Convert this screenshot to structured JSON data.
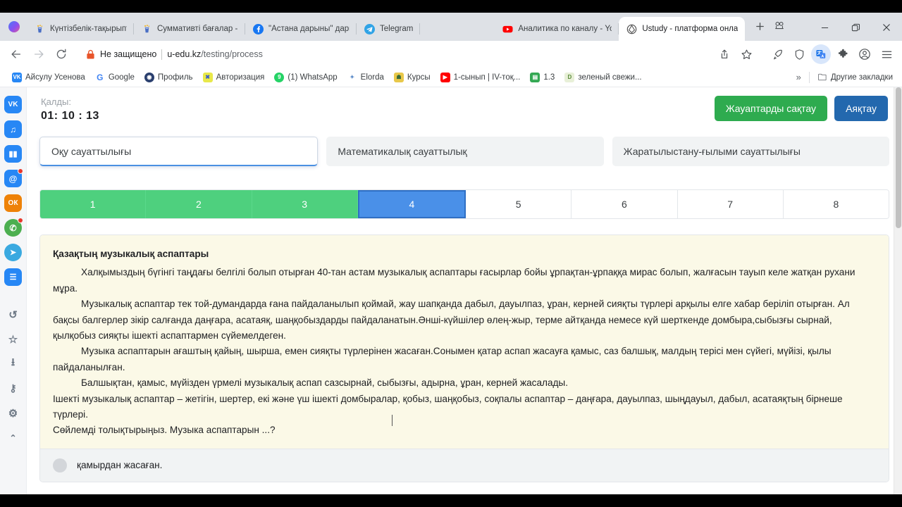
{
  "browser": {
    "tabs": [
      {
        "title": "Күнтізбелік-тақырыптық",
        "icon": "kundelik-icon",
        "active": false
      },
      {
        "title": "Суммативті бағалар - Kun",
        "icon": "kundelik-icon",
        "active": false
      },
      {
        "title": "\"Астана дарыны\" дарынд",
        "icon": "facebook-icon",
        "active": false
      },
      {
        "title": "Telegram",
        "icon": "telegram-icon",
        "active": false
      },
      {
        "title": "Аналитика по каналу - Yo",
        "icon": "youtube-icon",
        "active": false
      },
      {
        "title": "Ustudy - платформа онла",
        "icon": "ustudy-icon",
        "active": true
      }
    ],
    "new_tab_label": "+",
    "omnibox": {
      "security_text": "Не защищено",
      "url_host": "u-edu.kz",
      "url_path": "/testing/process"
    },
    "window_controls": {
      "minimize": "—",
      "maximize": "▢",
      "close": "✕"
    },
    "bookmarks": [
      {
        "label": "Айсулу Усенова",
        "icon": "vk-icon"
      },
      {
        "label": "Google",
        "icon": "google-icon"
      },
      {
        "label": "Профиль",
        "icon": "profile-icon"
      },
      {
        "label": "Авторизация",
        "icon": "auth-icon"
      },
      {
        "label": "(1) WhatsApp",
        "icon": "whatsapp-icon"
      },
      {
        "label": "Elorda",
        "icon": "elorda-icon"
      },
      {
        "label": "Курсы",
        "icon": "courses-icon"
      },
      {
        "label": "1-сынып | IV-тоқ...",
        "icon": "youtube-icon"
      },
      {
        "label": "1.3",
        "icon": "sheets-icon"
      },
      {
        "label": "зеленый свежи...",
        "icon": "doc-icon"
      }
    ],
    "bookmarks_overflow": "»",
    "other_bookmarks": "Другие закладки"
  },
  "rail": {
    "items": [
      {
        "name": "vk-icon",
        "glyph": "VK",
        "color": "#2787f5",
        "badge": false
      },
      {
        "name": "music-icon",
        "glyph": "♫",
        "color": "#2787f5",
        "badge": false
      },
      {
        "name": "stats-icon",
        "glyph": "▮▮",
        "color": "#2787f5",
        "badge": false
      },
      {
        "name": "mail-icon",
        "glyph": "@",
        "color": "#2787f5",
        "badge": true
      },
      {
        "name": "odnoklassniki-icon",
        "glyph": "ОК",
        "color": "#ee8208",
        "badge": false
      },
      {
        "name": "whatsapp-icon",
        "glyph": "✆",
        "color": "#4caf50",
        "badge": true
      },
      {
        "name": "telegram-icon",
        "glyph": "➤",
        "color": "#3aa9e0",
        "badge": false
      },
      {
        "name": "list-icon",
        "glyph": "☰",
        "color": "#2787f5",
        "badge": false
      },
      {
        "name": "history-icon",
        "glyph": "↺",
        "color": "",
        "badge": false
      },
      {
        "name": "star-icon",
        "glyph": "☆",
        "color": "",
        "badge": false
      },
      {
        "name": "download-icon",
        "glyph": "⭳",
        "color": "",
        "badge": false
      },
      {
        "name": "key-icon",
        "glyph": "⚷",
        "color": "",
        "badge": false
      },
      {
        "name": "gear-icon",
        "glyph": "⚙",
        "color": "",
        "badge": false
      },
      {
        "name": "collapse-icon",
        "glyph": "⌃",
        "color": "",
        "badge": false
      }
    ]
  },
  "test": {
    "timer_label": "Қалды:",
    "timer_value": "01: 10 : 13",
    "save_button": "Жауаптарды сақтау",
    "finish_button": "Аяқтау",
    "save_color": "#2eab4f",
    "finish_color": "#2368ae",
    "subjects": [
      {
        "label": "Оқу сауаттылығы",
        "active": true
      },
      {
        "label": "Математикалық сауаттылық",
        "active": false
      },
      {
        "label": "Жаратылыстану-ғылыми сауаттылығы",
        "active": false
      }
    ],
    "question_numbers": [
      {
        "n": "1",
        "state": "done"
      },
      {
        "n": "2",
        "state": "done"
      },
      {
        "n": "3",
        "state": "done"
      },
      {
        "n": "4",
        "state": "current"
      },
      {
        "n": "5",
        "state": "pending"
      },
      {
        "n": "6",
        "state": "pending"
      },
      {
        "n": "7",
        "state": "pending"
      },
      {
        "n": "8",
        "state": "pending"
      }
    ],
    "passage": {
      "title": "Қазақтың музыкалық аспаптары",
      "paragraphs": [
        "Халқымыздың бүгінгі таңдағы белгілі болып отырған 40-тан астам музыкалық аспаптары ғасырлар бойы ұрпақтан-ұрпаққа мирас болып, жалғасын тауып келе жатқан рухани мұра.",
        "Музыкалық аспаптар тек той-думандарда ғана пайдаланылып қоймай, жау шапқанда дабыл, дауылпаз, ұран, керней сияқты түрлері арқылы елге хабар беріліп отырған. Ал бақсы балгерлер зікір салғанда даңғара, асатаяқ, шаңқобыздарды пайдаланатын.Әнші-күйшілер өлең-жыр, терме айтқанда немесе күй шерткенде домбыра,сыбызғы сырнай, қылқобыз сияқты ішекті аспаптармен сүйемелдеген.",
        "Музыка аспаптарын ағаштың қайың, шырша, емен сияқты түрлерінен жасаған.Сонымен қатар аспап жасауға қамыс, саз балшық, малдың терісі мен сүйегі, мүйізі, қылы пайдаланылған.",
        "Балшықтан, қамыс, мүйізден үрмелі музыкалық аспап сазсырнай, сыбызғы, адырна, ұран, керней жасалады."
      ],
      "tail_lines": [
        "Ішекті музыкалық аспаптар – жетігін, шертер, екі және үш ішекті домбыралар, қобыз, шаңқобыз, соқпалы аспаптар – даңғара, дауылпаз, шыңдауыл, дабыл, асатаяқтың бірнеше түрлері.",
        "Сөйлемді толықтырыңыз. Музыка аспаптарын ...?"
      ]
    },
    "options": [
      {
        "label": "қамырдан жасаған.",
        "selected": false
      }
    ]
  }
}
